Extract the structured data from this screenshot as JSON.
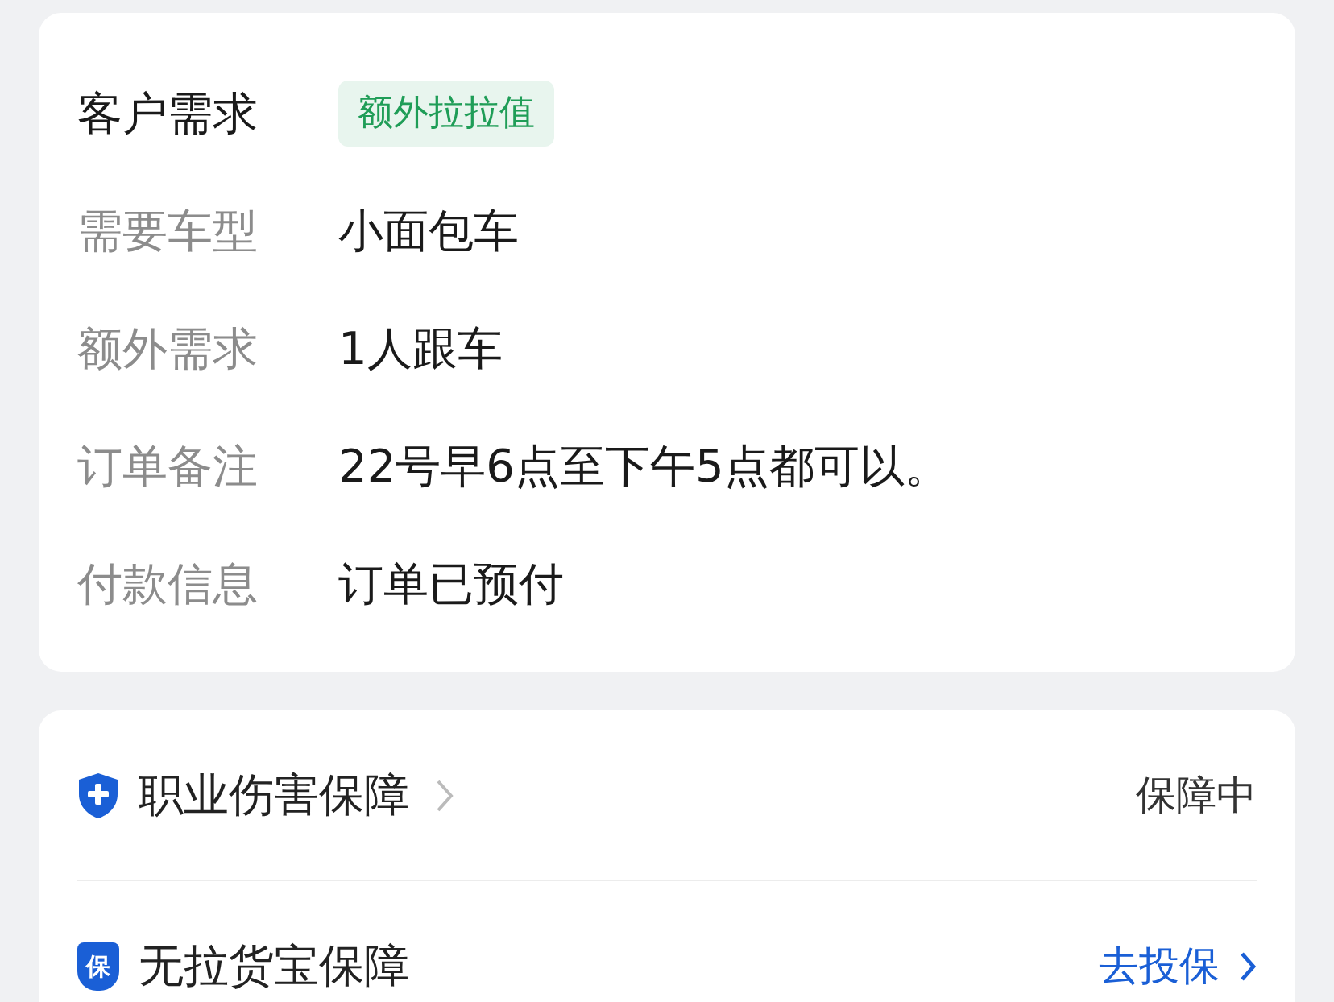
{
  "order_details": [
    {
      "label": "客户需求",
      "emphasis": true,
      "value": "额外拉拉值",
      "kind": "tag"
    },
    {
      "label": "需要车型",
      "emphasis": false,
      "value": "小面包车",
      "kind": "text"
    },
    {
      "label": "额外需求",
      "emphasis": false,
      "value": "1人跟车",
      "kind": "text"
    },
    {
      "label": "订单备注",
      "emphasis": false,
      "value": "22号早6点至下午5点都可以。",
      "kind": "text"
    },
    {
      "label": "付款信息",
      "emphasis": false,
      "value": "订单已预付",
      "kind": "text"
    }
  ],
  "protections": [
    {
      "title": "职业伤害保障",
      "has_chevron": true,
      "kind": "status",
      "right_text": "保障中"
    },
    {
      "icon_char": "保",
      "title": "无拉货宝保障",
      "has_chevron": false,
      "kind": "action",
      "right_text": "去投保"
    }
  ]
}
